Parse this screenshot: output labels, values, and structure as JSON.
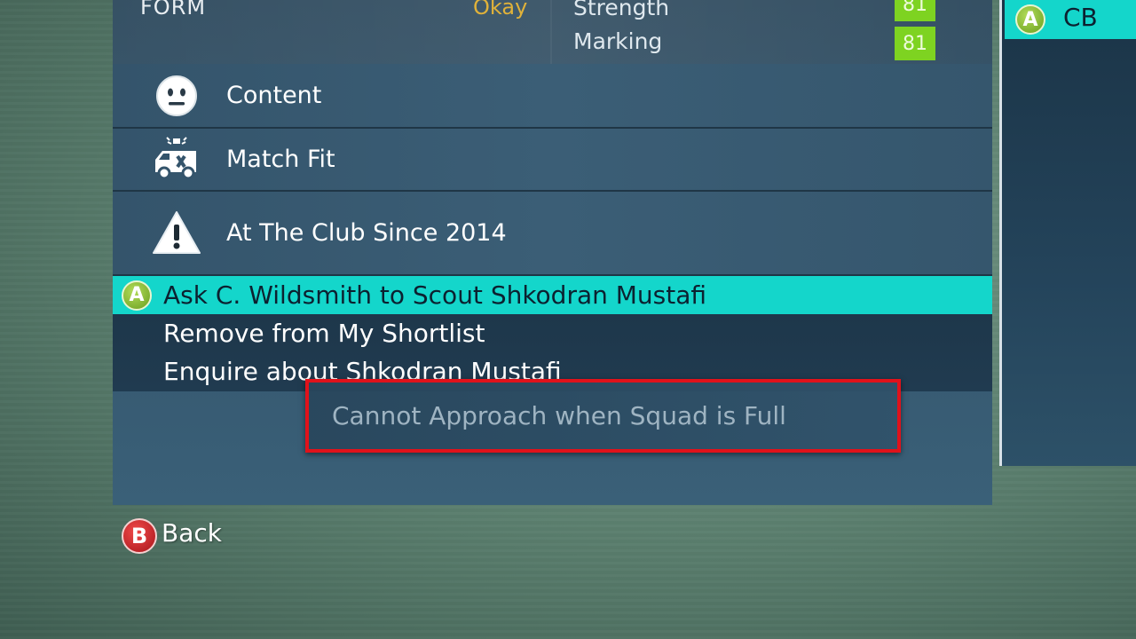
{
  "header": {
    "form_label": "FORM",
    "form_value": "Okay",
    "stats": [
      {
        "name": "Strength",
        "value": "81"
      },
      {
        "name": "Marking",
        "value": "81"
      }
    ]
  },
  "status_rows": [
    {
      "label": "Content",
      "icon": "neutral-face-icon"
    },
    {
      "label": "Match Fit",
      "icon": "ambulance-icon"
    },
    {
      "label": "At The Club Since 2014",
      "icon": "warning-triangle-icon"
    }
  ],
  "menu": {
    "items": [
      {
        "label": "Ask C. Wildsmith to Scout Shkodran Mustafi",
        "selected": true,
        "button": "A"
      },
      {
        "label": "Remove from My Shortlist",
        "selected": false
      },
      {
        "label": "Enquire about Shkodran Mustafi",
        "selected": false
      }
    ]
  },
  "tooltip": {
    "text": "Cannot Approach when Squad is Full"
  },
  "side_panel": {
    "button": "A",
    "position": "CB"
  },
  "footer": {
    "back_button": "B",
    "back_label": "Back"
  },
  "colors": {
    "accent": "#14d6cb",
    "stat_badge": "#7ed321",
    "form_value": "#e0b23a",
    "tooltip_border": "#e0121b"
  }
}
